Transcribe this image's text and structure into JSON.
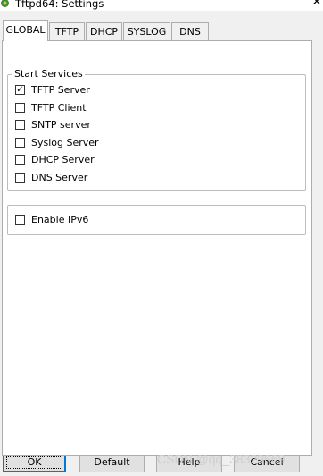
{
  "window": {
    "title": "Tftpd64: Settings",
    "close_glyph": "✕",
    "icon": "tftpd64-app-icon"
  },
  "tabs": [
    {
      "label": "GLOBAL",
      "active": true
    },
    {
      "label": "TFTP",
      "active": false
    },
    {
      "label": "DHCP",
      "active": false
    },
    {
      "label": "SYSLOG",
      "active": false
    },
    {
      "label": "DNS",
      "active": false
    }
  ],
  "start_services": {
    "legend": "Start Services",
    "items": [
      {
        "label": "TFTP Server",
        "checked": true
      },
      {
        "label": "TFTP Client",
        "checked": false
      },
      {
        "label": "SNTP server",
        "checked": false
      },
      {
        "label": "Syslog Server",
        "checked": false
      },
      {
        "label": "DHCP Server",
        "checked": false
      },
      {
        "label": "DNS Server",
        "checked": false
      }
    ]
  },
  "ipv6": {
    "label": "Enable IPv6",
    "checked": false
  },
  "buttons": {
    "ok": "OK",
    "default": "Default",
    "help": "Help",
    "cancel": "Cancel"
  },
  "watermark": "CSDN @qq_38329669",
  "check_glyph": "✓",
  "colors": {
    "dialog_bg": "#f0f0f0",
    "panel_bg": "#ffffff",
    "focus_border": "#0078d7"
  }
}
